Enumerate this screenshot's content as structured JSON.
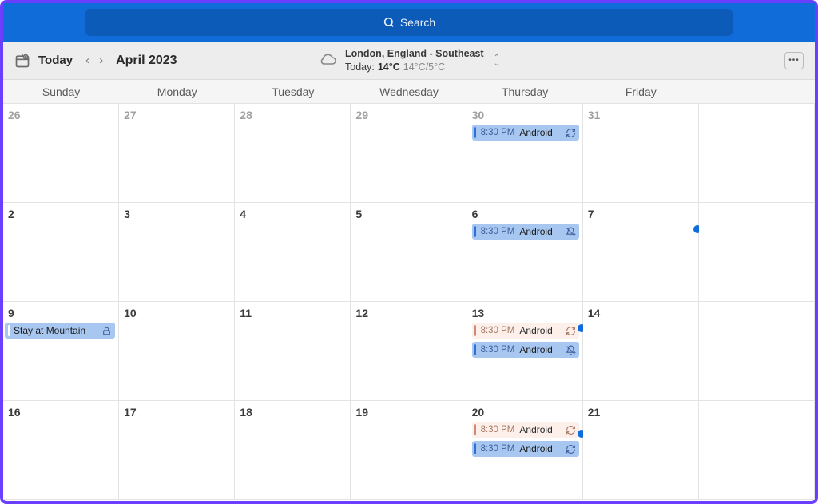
{
  "search": {
    "placeholder": "Search"
  },
  "toolbar": {
    "today": "Today",
    "month": "April 2023"
  },
  "weather": {
    "location": "London, England - Southeast",
    "today_label": "Today:",
    "temp": "14°C",
    "range": "14°C/5°C"
  },
  "dow": [
    "Sunday",
    "Monday",
    "Tuesday",
    "Wednesday",
    "Thursday",
    "Friday",
    ""
  ],
  "weeks": [
    {
      "days": [
        {
          "n": "26",
          "out": true,
          "events": []
        },
        {
          "n": "27",
          "out": true,
          "events": []
        },
        {
          "n": "28",
          "out": true,
          "events": []
        },
        {
          "n": "29",
          "out": true,
          "events": []
        },
        {
          "n": "30",
          "out": true,
          "events": [
            {
              "style": "blue",
              "time": "8:30 PM",
              "title": "Android",
              "icon": "repeat"
            }
          ]
        },
        {
          "n": "31",
          "out": true,
          "events": []
        },
        {
          "n": "",
          "events": []
        }
      ]
    },
    {
      "days": [
        {
          "n": "2",
          "events": []
        },
        {
          "n": "3",
          "events": []
        },
        {
          "n": "4",
          "events": []
        },
        {
          "n": "5",
          "events": []
        },
        {
          "n": "6",
          "events": [
            {
              "style": "blue",
              "time": "8:30 PM",
              "title": "Android",
              "icon": "bell-off"
            }
          ]
        },
        {
          "n": "7",
          "events": [],
          "dot": true
        },
        {
          "n": "",
          "events": []
        }
      ]
    },
    {
      "days": [
        {
          "n": "9",
          "events": [],
          "allday": {
            "title": "Stay at Mountain"
          }
        },
        {
          "n": "10",
          "events": []
        },
        {
          "n": "11",
          "events": []
        },
        {
          "n": "12",
          "events": []
        },
        {
          "n": "13",
          "events": [
            {
              "style": "pale",
              "time": "8:30 PM",
              "title": "Android",
              "icon": "repeat"
            },
            {
              "style": "blue",
              "time": "8:30 PM",
              "title": "Android",
              "icon": "bell-off"
            }
          ],
          "dot": true
        },
        {
          "n": "14",
          "events": []
        },
        {
          "n": "",
          "events": []
        }
      ]
    },
    {
      "days": [
        {
          "n": "16",
          "events": []
        },
        {
          "n": "17",
          "events": []
        },
        {
          "n": "18",
          "events": []
        },
        {
          "n": "19",
          "events": []
        },
        {
          "n": "20",
          "events": [
            {
              "style": "pale",
              "time": "8:30 PM",
              "title": "Android",
              "icon": "repeat"
            },
            {
              "style": "blue",
              "time": "8:30 PM",
              "title": "Android",
              "icon": "repeat"
            }
          ],
          "dot": true
        },
        {
          "n": "21",
          "events": []
        },
        {
          "n": "",
          "events": []
        }
      ]
    }
  ]
}
